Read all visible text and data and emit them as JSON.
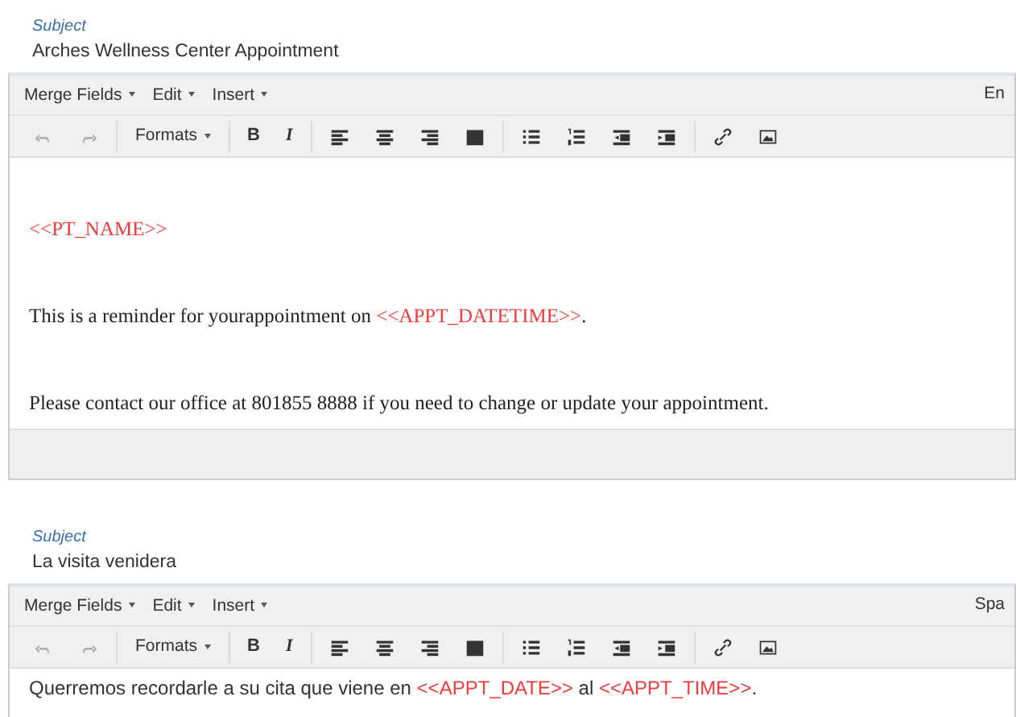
{
  "editors": [
    {
      "subject_label": "Subject",
      "subject_value": "Arches Wellness Center Appointment",
      "menus": [
        "Merge Fields",
        "Edit",
        "Insert"
      ],
      "language": "En",
      "formats_label": "Formats",
      "bold_label": "B",
      "italic_label": "I",
      "serif": true,
      "paragraphs": [
        [
          {
            "kind": "merge",
            "text": "<<PT_NAME>>"
          }
        ],
        [
          {
            "kind": "plain",
            "text": "This is a reminder for yourappointment on "
          },
          {
            "kind": "merge",
            "text": "<<APPT_DATETIME>>"
          },
          {
            "kind": "plain",
            "text": "."
          }
        ],
        [
          {
            "kind": "plain",
            "text": "Please contact our office at 801855 8888 if you need to change or update your appointment."
          }
        ]
      ],
      "status_bar": true
    },
    {
      "subject_label": "Subject",
      "subject_value": "La visita venidera",
      "menus": [
        "Merge Fields",
        "Edit",
        "Insert"
      ],
      "language": "Spa",
      "formats_label": "Formats",
      "bold_label": "B",
      "italic_label": "I",
      "serif": false,
      "paragraphs": [
        [
          {
            "kind": "plain",
            "text": "Querremos recordarle a su cita que viene en "
          },
          {
            "kind": "merge",
            "text": "<<APPT_DATE>>"
          },
          {
            "kind": "plain",
            "text": " al "
          },
          {
            "kind": "merge",
            "text": "<<APPT_TIME>>"
          },
          {
            "kind": "plain",
            "text": "."
          }
        ]
      ],
      "status_bar": false
    }
  ]
}
